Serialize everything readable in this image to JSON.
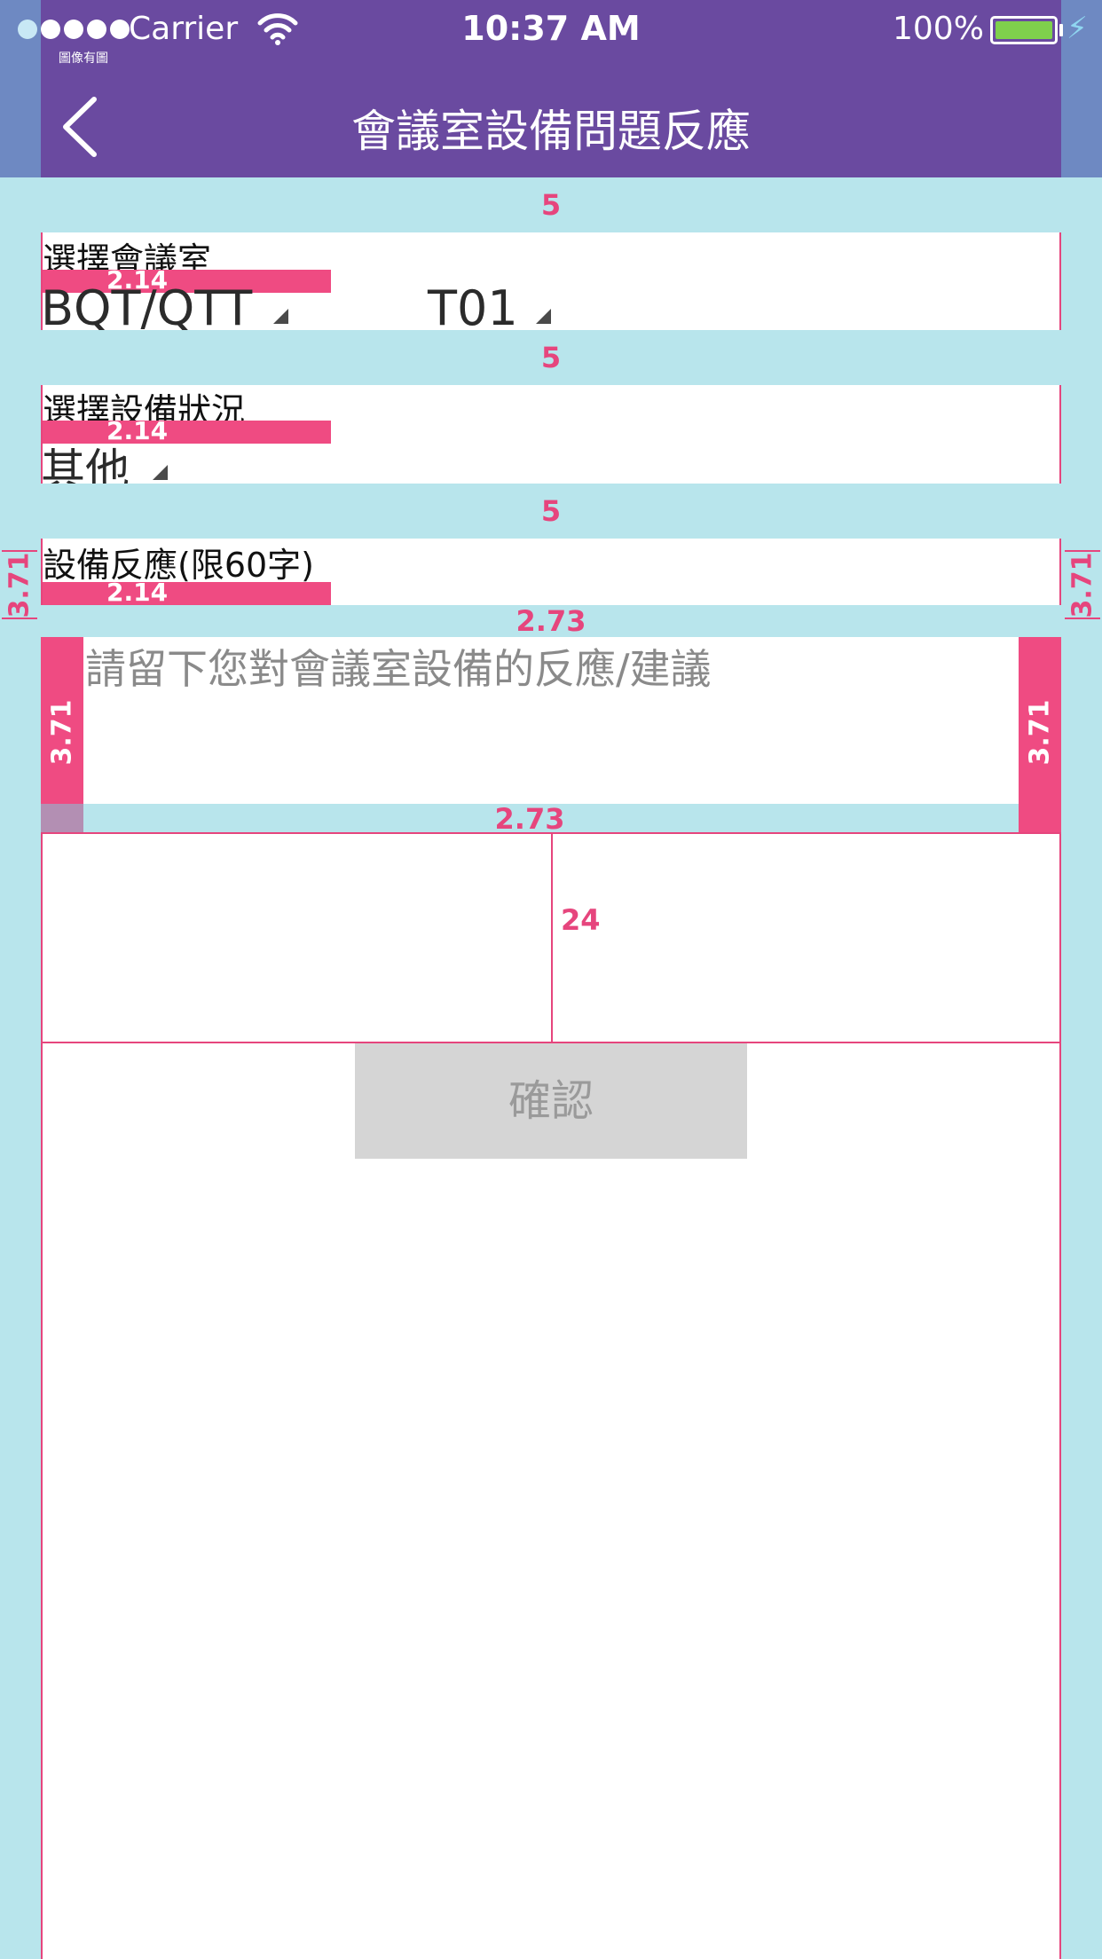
{
  "status_bar": {
    "carrier": "Carrier",
    "time": "10:37 AM",
    "battery_percent": "100%",
    "tiny_label": "圖像有圖"
  },
  "nav": {
    "title": "會議室設備問題反應",
    "back_icon": "chevron-left-icon"
  },
  "spacing_labels": {
    "band_top": "5",
    "band_mid": "5",
    "band_bottom": "5",
    "gap_before_input": "2.73",
    "gap_after_input": "2.73",
    "label_gap_1": "2.14",
    "label_gap_2": "2.14",
    "label_gap_3": "2.14",
    "side_left": "3.71",
    "side_right": "3.71",
    "input_left": "3.71",
    "input_right": "3.71",
    "button_gap": "24"
  },
  "room_section": {
    "label": "選擇會議室",
    "building": "BQT/QTT",
    "room": "T01"
  },
  "status_section": {
    "label": "選擇設備狀況",
    "value": "其他"
  },
  "feedback_section": {
    "label": "設備反應(限60字)",
    "placeholder": "請留下您對會議室設備的反應/建議"
  },
  "confirm_button": {
    "label": "確認"
  },
  "colors": {
    "header": "#6a4aa0",
    "band": "#b8e5ec",
    "accent_pink": "#ef4b82",
    "button": "#d5d5d5"
  }
}
